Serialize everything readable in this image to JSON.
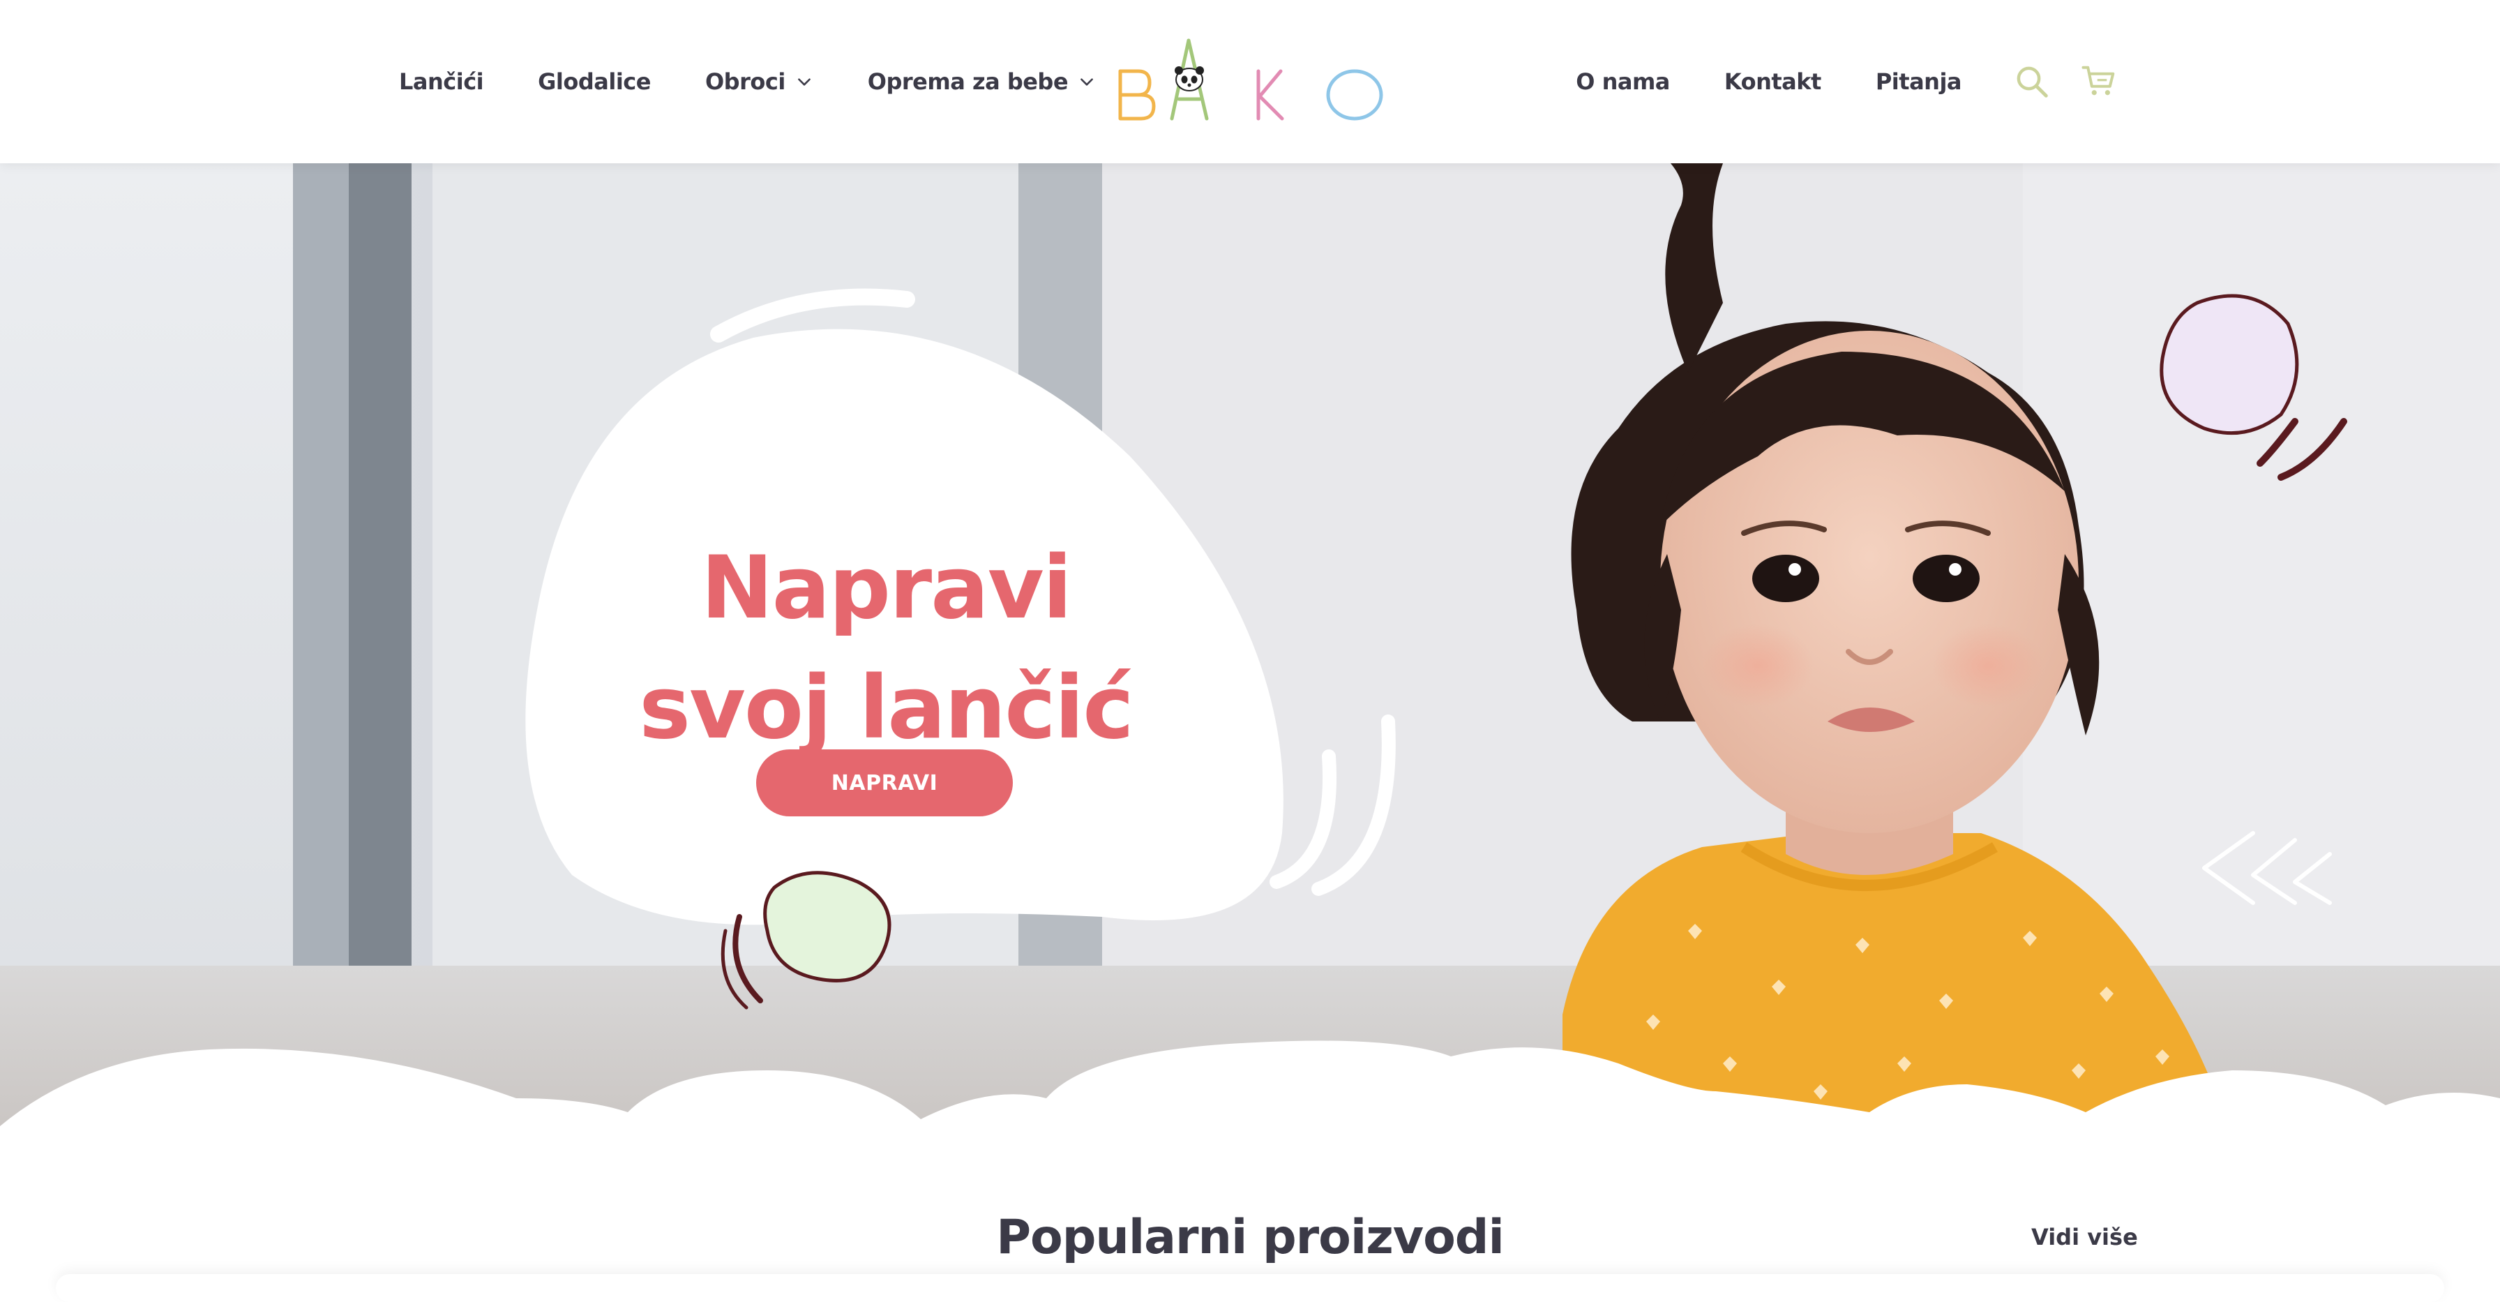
{
  "nav": {
    "left": [
      {
        "label": "Lančići",
        "dropdown": false
      },
      {
        "label": "Glodalice",
        "dropdown": false
      },
      {
        "label": "Obroci",
        "dropdown": true
      },
      {
        "label": "Oprema za bebe",
        "dropdown": true
      }
    ],
    "right": [
      {
        "label": "O nama"
      },
      {
        "label": "Kontakt"
      },
      {
        "label": "Pitanja"
      }
    ],
    "icons": [
      "search-icon",
      "cart-icon"
    ]
  },
  "logo": {
    "letters": [
      "B",
      "A",
      "K",
      "O"
    ],
    "colors": [
      "#f2b54b",
      "#a3c77a",
      "#e28bb3",
      "#8ec6e8"
    ]
  },
  "hero": {
    "title_line1": "Napravi",
    "title_line2": "svoj lančić",
    "button_label": "NAPRAVI"
  },
  "popular": {
    "title": "Popularni proizvodi",
    "see_more": "Vidi više"
  },
  "colors": {
    "accent": "#e5676e",
    "text": "#3b3a47",
    "icon": "#cbd39a",
    "outline": "#5a1a1f"
  }
}
